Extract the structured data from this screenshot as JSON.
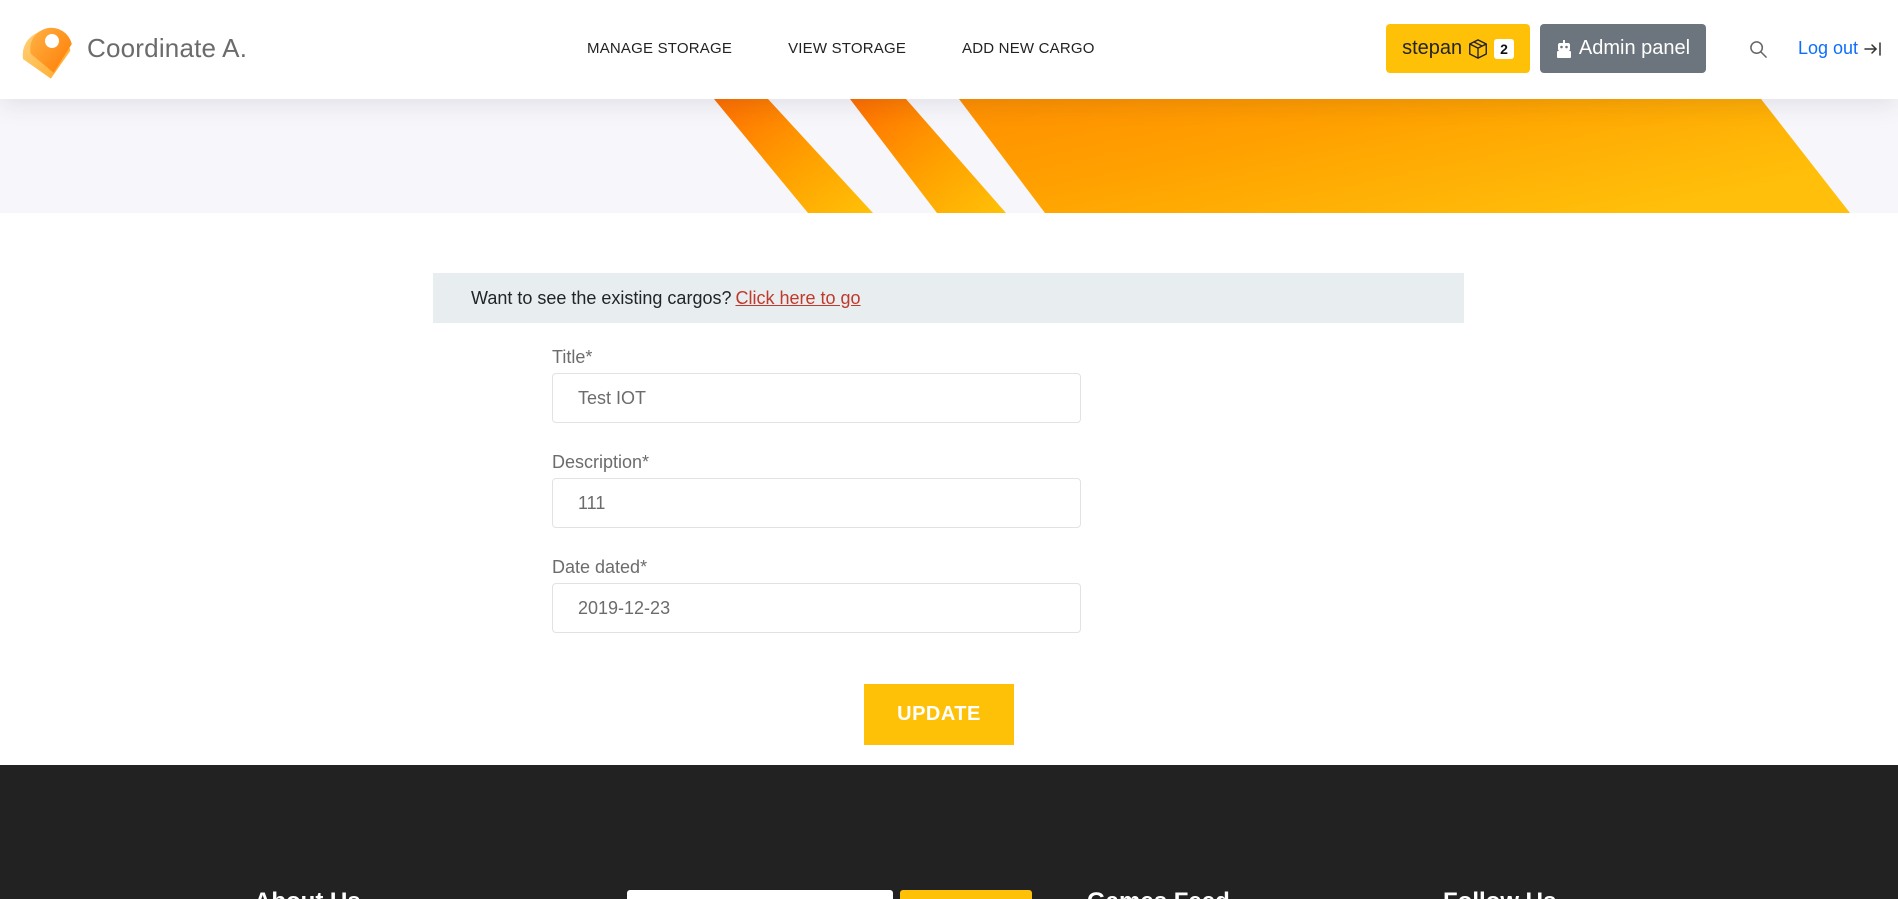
{
  "header": {
    "brand": "Coordinate A.",
    "nav": {
      "manage_storage": "MANAGE STORAGE",
      "view_storage": "VIEW STORAGE",
      "add_new_cargo": "ADD NEW CARGO"
    },
    "user": {
      "name": "stepan",
      "cart_count": "2",
      "icon": "box-icon"
    },
    "admin_panel": {
      "label": "Admin panel",
      "icon": "robot-icon"
    },
    "search_icon": "search-icon",
    "logout": {
      "label": "Log out",
      "icon": "logout-arrow-icon"
    }
  },
  "notice": {
    "text": "Want to see the existing cargos?",
    "link_text": "Click here to go"
  },
  "form": {
    "title": {
      "label": "Title*",
      "value": "Test IOT"
    },
    "description": {
      "label": "Description*",
      "value": "111"
    },
    "date_dated": {
      "label": "Date dated*",
      "value": "2019-12-23"
    },
    "submit_label": "UPDATE"
  },
  "footer": {
    "about_heading": "About Us",
    "newsletter_button": "",
    "games_feed_heading": "Games Feed",
    "follow_heading": "Follow Us"
  },
  "colors": {
    "accent": "#ffc107",
    "secondary": "#6c757d",
    "link": "#0d6efd",
    "notice_link": "#c0392b",
    "footer_bg": "#222222"
  }
}
